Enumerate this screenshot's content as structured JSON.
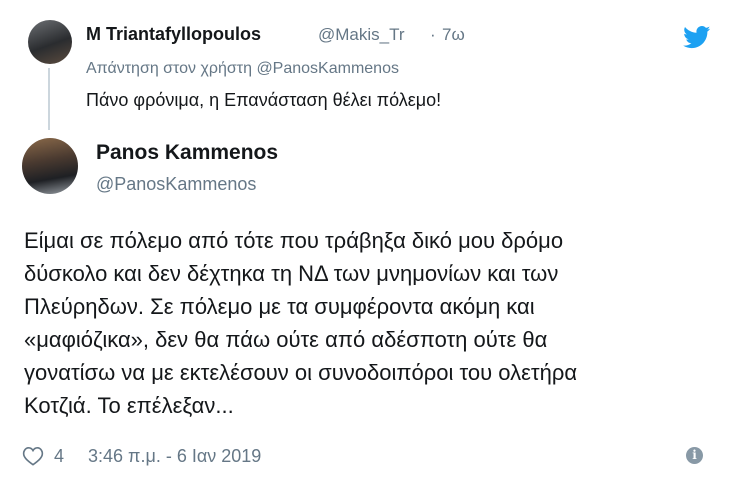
{
  "reply": {
    "author_name": "M Triantafyllopoulos",
    "author_handle": "@Makis_Tr",
    "separator": "·",
    "time": "7ω",
    "replying_prefix": "Απάντηση στον χρήστη",
    "replying_to": "@PanosKammenos",
    "text": "Πάνο φρόνιμα, η Επανάσταση θέλει πόλεμο!"
  },
  "main": {
    "author_name": "Panos Kammenos",
    "author_handle": "@PanosKammenos",
    "lines": [
      "Είμαι σε πόλεμο από τότε που τράβηξα δικό μου δρόμο",
      "δύσκολο και δεν δέχτηκα τη ΝΔ των μνημονίων και των",
      "Πλεύρηδων. Σε πόλεμο με τα συμφέροντα ακόμη και",
      "«μαφιόζικα», δεν θα πάω ούτε από αδέσποτη ούτε θα",
      "γονατίσω να με εκτελέσουν οι συνοδοιπόροι του ολετήρα",
      "Κοτζιά. Το επέλεξαν..."
    ],
    "like_count": "4",
    "timestamp": "3:46 π.μ. - 6 Ιαν 2019"
  },
  "icons": {
    "logo": "twitter-bird-icon",
    "like": "heart-icon",
    "info": "info-icon"
  },
  "colors": {
    "brand": "#1da1f2",
    "secondary_text": "#657786",
    "primary_text": "#14171a"
  }
}
